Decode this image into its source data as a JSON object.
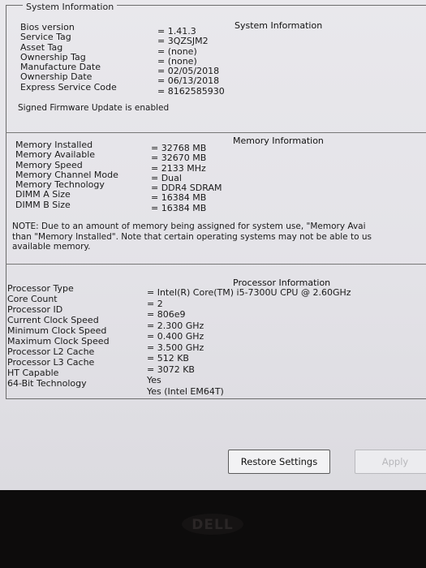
{
  "window": {
    "group_title": "System Information"
  },
  "system": {
    "header": "System Information",
    "labels": [
      "Bios version",
      "Service Tag",
      "Asset Tag",
      "Ownership Tag",
      "Manufacture Date",
      "Ownership Date",
      "Express Service Code"
    ],
    "values": [
      "= 1.41.3",
      "= 3QZSJM2",
      "= (none)",
      "= (none)",
      "= 02/05/2018",
      "= 06/13/2018",
      "= 8162585930"
    ],
    "firmware_note": "Signed Firmware Update is enabled"
  },
  "memory": {
    "header": "Memory Information",
    "labels": [
      "Memory Installed",
      "Memory Available",
      "Memory Speed",
      "Memory Channel Mode",
      "Memory Technology",
      "DIMM A Size",
      "DIMM B Size"
    ],
    "values": [
      "= 32768 MB",
      "= 32670 MB",
      "= 2133 MHz",
      "= Dual",
      "= DDR4 SDRAM",
      "= 16384 MB",
      "= 16384 MB"
    ],
    "note_lines": [
      "NOTE: Due to an amount of memory being assigned for system use, \"Memory Avai",
      "than \"Memory Installed\". Note that certain operating systems may not be able to us",
      "available memory."
    ]
  },
  "processor": {
    "header": "Processor Information",
    "labels": [
      "Processor Type",
      "Core Count",
      "Processor ID",
      "Current Clock Speed",
      "Minimum Clock Speed",
      "Maximum Clock Speed",
      "Processor L2 Cache",
      "Processor L3 Cache",
      "HT Capable",
      "64-Bit Technology"
    ],
    "values": [
      "= Intel(R) Core(TM) i5-7300U CPU @ 2.60GHz",
      "= 2",
      "= 806e9",
      "= 2.300 GHz",
      "= 0.400 GHz",
      "= 3.500 GHz",
      "= 512 KB",
      "= 3072 KB",
      "Yes",
      "Yes (Intel EM64T)"
    ]
  },
  "buttons": {
    "restore": "Restore Settings",
    "apply": "Apply"
  },
  "bezel": {
    "logo_icon": "dell-logo-icon"
  }
}
